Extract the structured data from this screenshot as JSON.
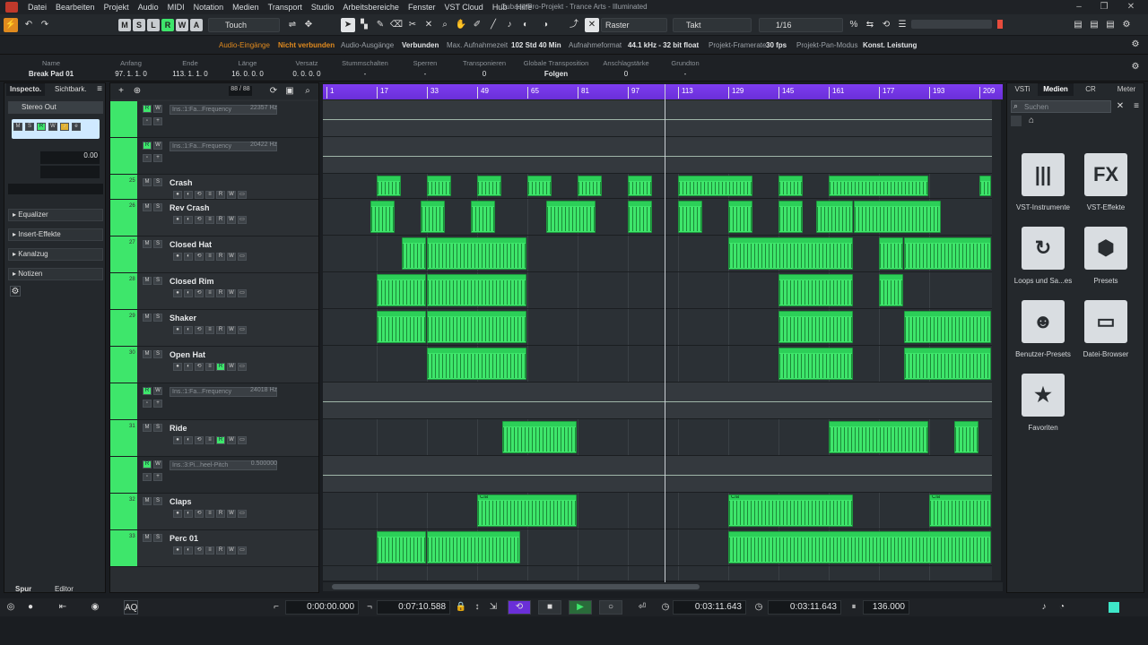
{
  "menu": {
    "items": [
      "Datei",
      "Bearbeiten",
      "Projekt",
      "Audio",
      "MIDI",
      "Notation",
      "Medien",
      "Transport",
      "Studio",
      "Arbeitsbereiche",
      "Fenster",
      "VST Cloud",
      "Hub",
      "Hilfe"
    ],
    "title": "Cubase Pro-Projekt - Trance Arts - Illuminated"
  },
  "toolbar": {
    "automation_mode": "Touch",
    "grid_type": "Raster",
    "grid_type2": "Takt",
    "quantize": "1/16",
    "msrw": [
      "M",
      "S",
      "L",
      "R",
      "W",
      "A"
    ]
  },
  "infobar": {
    "audio_in_label": "Audio-Eingänge",
    "audio_in_value": "Nicht verbunden",
    "audio_out_label": "Audio-Ausgänge",
    "audio_out_value": "Verbunden",
    "max_rec_label": "Max. Aufnahmezeit",
    "max_rec_value": "102 Std 40 Min",
    "rec_format_label": "Aufnahmeformat",
    "rec_format_value": "44.1 kHz - 32 bit float",
    "framerate_label": "Projekt-Framerate",
    "framerate_value": "30 fps",
    "pan_label": "Projekt-Pan-Modus",
    "pan_value": "Konst. Leistung"
  },
  "eventinfo": {
    "fields": [
      {
        "h": "Name",
        "v": "Break Pad 01"
      },
      {
        "h": "Anfang",
        "v": "97. 1. 1.   0"
      },
      {
        "h": "Ende",
        "v": "113. 1. 1.   0"
      },
      {
        "h": "Länge",
        "v": "16. 0. 0.   0"
      },
      {
        "h": "Versatz",
        "v": "0. 0. 0.   0"
      },
      {
        "h": "Stummschalten",
        "v": "-"
      },
      {
        "h": "Sperren",
        "v": "-"
      },
      {
        "h": "Transponieren",
        "v": "0"
      },
      {
        "h": "Globale Transposition",
        "v": "Folgen"
      },
      {
        "h": "Anschlagstärke",
        "v": "0"
      },
      {
        "h": "Grundton",
        "v": "-"
      }
    ]
  },
  "inspector": {
    "tab1": "Inspecto.",
    "tab2": "Sichtbark.",
    "output": "Stereo Out",
    "volume": "0.00",
    "sections": [
      "Equalizer",
      "Insert-Effekte",
      "Kanalzug",
      "Notizen"
    ],
    "bottom_tab1": "Spur",
    "bottom_tab2": "Editor"
  },
  "tracklist": {
    "counter": "88 / 88"
  },
  "tracks": [
    {
      "type": "auto",
      "param": "Ins.:1:Fa...Frequency",
      "value": "22357 Hz"
    },
    {
      "type": "auto",
      "param": "Ins.:1:Fa...Frequency",
      "value": "20422 Hz"
    },
    {
      "type": "track",
      "num": "25",
      "name": "Crash"
    },
    {
      "type": "track",
      "num": "26",
      "name": "Rev Crash"
    },
    {
      "type": "track",
      "num": "27",
      "name": "Closed Hat"
    },
    {
      "type": "track",
      "num": "28",
      "name": "Closed Rim"
    },
    {
      "type": "track",
      "num": "29",
      "name": "Shaker"
    },
    {
      "type": "track",
      "num": "30",
      "name": "Open Hat"
    },
    {
      "type": "auto",
      "param": "Ins.:1:Fa...Frequency",
      "value": "24018 Hz"
    },
    {
      "type": "track",
      "num": "31",
      "name": "Ride"
    },
    {
      "type": "auto",
      "param": "Ins.:3:Pi...heel-Pitch",
      "value": "0.500000"
    },
    {
      "type": "track",
      "num": "32",
      "name": "Claps"
    },
    {
      "type": "track",
      "num": "33",
      "name": "Perc 01"
    }
  ],
  "ruler": {
    "bars": [
      "1",
      "17",
      "33",
      "49",
      "65",
      "81",
      "97",
      "113",
      "129",
      "145",
      "161",
      "177",
      "193",
      "209"
    ]
  },
  "clip_labels": {
    "claps": "Cla"
  },
  "rightzone": {
    "tabs": [
      "VSTi",
      "Medien",
      "CR",
      "Meter"
    ],
    "search_placeholder": "Suchen",
    "items": [
      {
        "icon": "vst-instruments-icon",
        "glyph": "|||",
        "label": "VST-Instrumente"
      },
      {
        "icon": "vst-effects-icon",
        "glyph": "FX",
        "label": "VST-Effekte"
      },
      {
        "icon": "loops-icon",
        "glyph": "↻",
        "label": "Loops und Sa...es"
      },
      {
        "icon": "presets-icon",
        "glyph": "⬢",
        "label": "Presets"
      },
      {
        "icon": "user-presets-icon",
        "glyph": "☻",
        "label": "Benutzer-Presets"
      },
      {
        "icon": "file-browser-icon",
        "glyph": "▭",
        "label": "Datei-Browser"
      },
      {
        "icon": "favorites-icon",
        "glyph": "★",
        "label": "Favoriten"
      }
    ]
  },
  "transport": {
    "left_locator": "0:00:00.000",
    "right_locator": "0:07:10.588",
    "position1": "0:03:11.643",
    "position2": "0:03:11.643",
    "tempo": "136.000"
  },
  "colors": {
    "track_green": "#3ee66b",
    "ruler_purple": "#7e3cf0",
    "record_red": "#e74c3c"
  }
}
